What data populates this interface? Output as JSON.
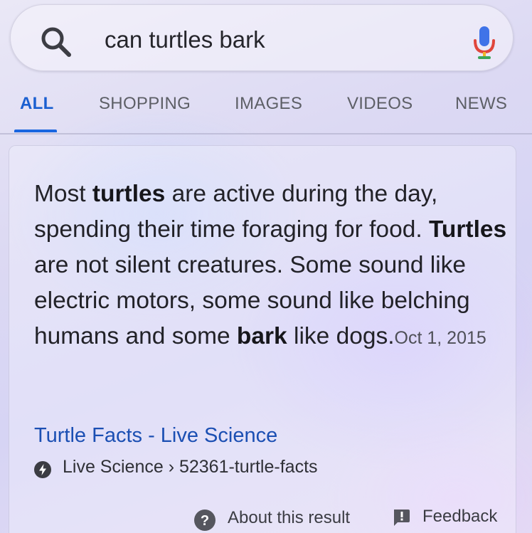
{
  "search": {
    "query": "can turtles bark",
    "search_icon": "search-icon",
    "mic_icon": "mic-icon"
  },
  "tabs": [
    {
      "label": "ALL",
      "active": true
    },
    {
      "label": "SHOPPING",
      "active": false
    },
    {
      "label": "IMAGES",
      "active": false
    },
    {
      "label": "VIDEOS",
      "active": false
    },
    {
      "label": "NEWS",
      "active": false
    }
  ],
  "snippet": {
    "segments": [
      {
        "text": "Most ",
        "bold": false
      },
      {
        "text": "turtles",
        "bold": true
      },
      {
        "text": " are active during the day, spending their time foraging for food. ",
        "bold": false
      },
      {
        "text": "Turtles",
        "bold": true
      },
      {
        "text": " are not silent creatures. Some sound like electric motors, some sound like belching humans and some ",
        "bold": false
      },
      {
        "text": "bark",
        "bold": true
      },
      {
        "text": " like dogs.",
        "bold": false
      }
    ],
    "date": "Oct 1, 2015"
  },
  "result": {
    "title": "Turtle Facts - Live Science",
    "source": "Live Science › 52361-turtle-facts",
    "amp_icon": "amp-lightning-icon"
  },
  "footer": {
    "about_label": "About this result",
    "feedback_label": "Feedback",
    "help_icon": "help-circle-icon",
    "feedback_icon": "feedback-flag-icon"
  },
  "colors": {
    "accent": "#1a66e0",
    "link": "#1b4fb3",
    "text": "#222228"
  }
}
